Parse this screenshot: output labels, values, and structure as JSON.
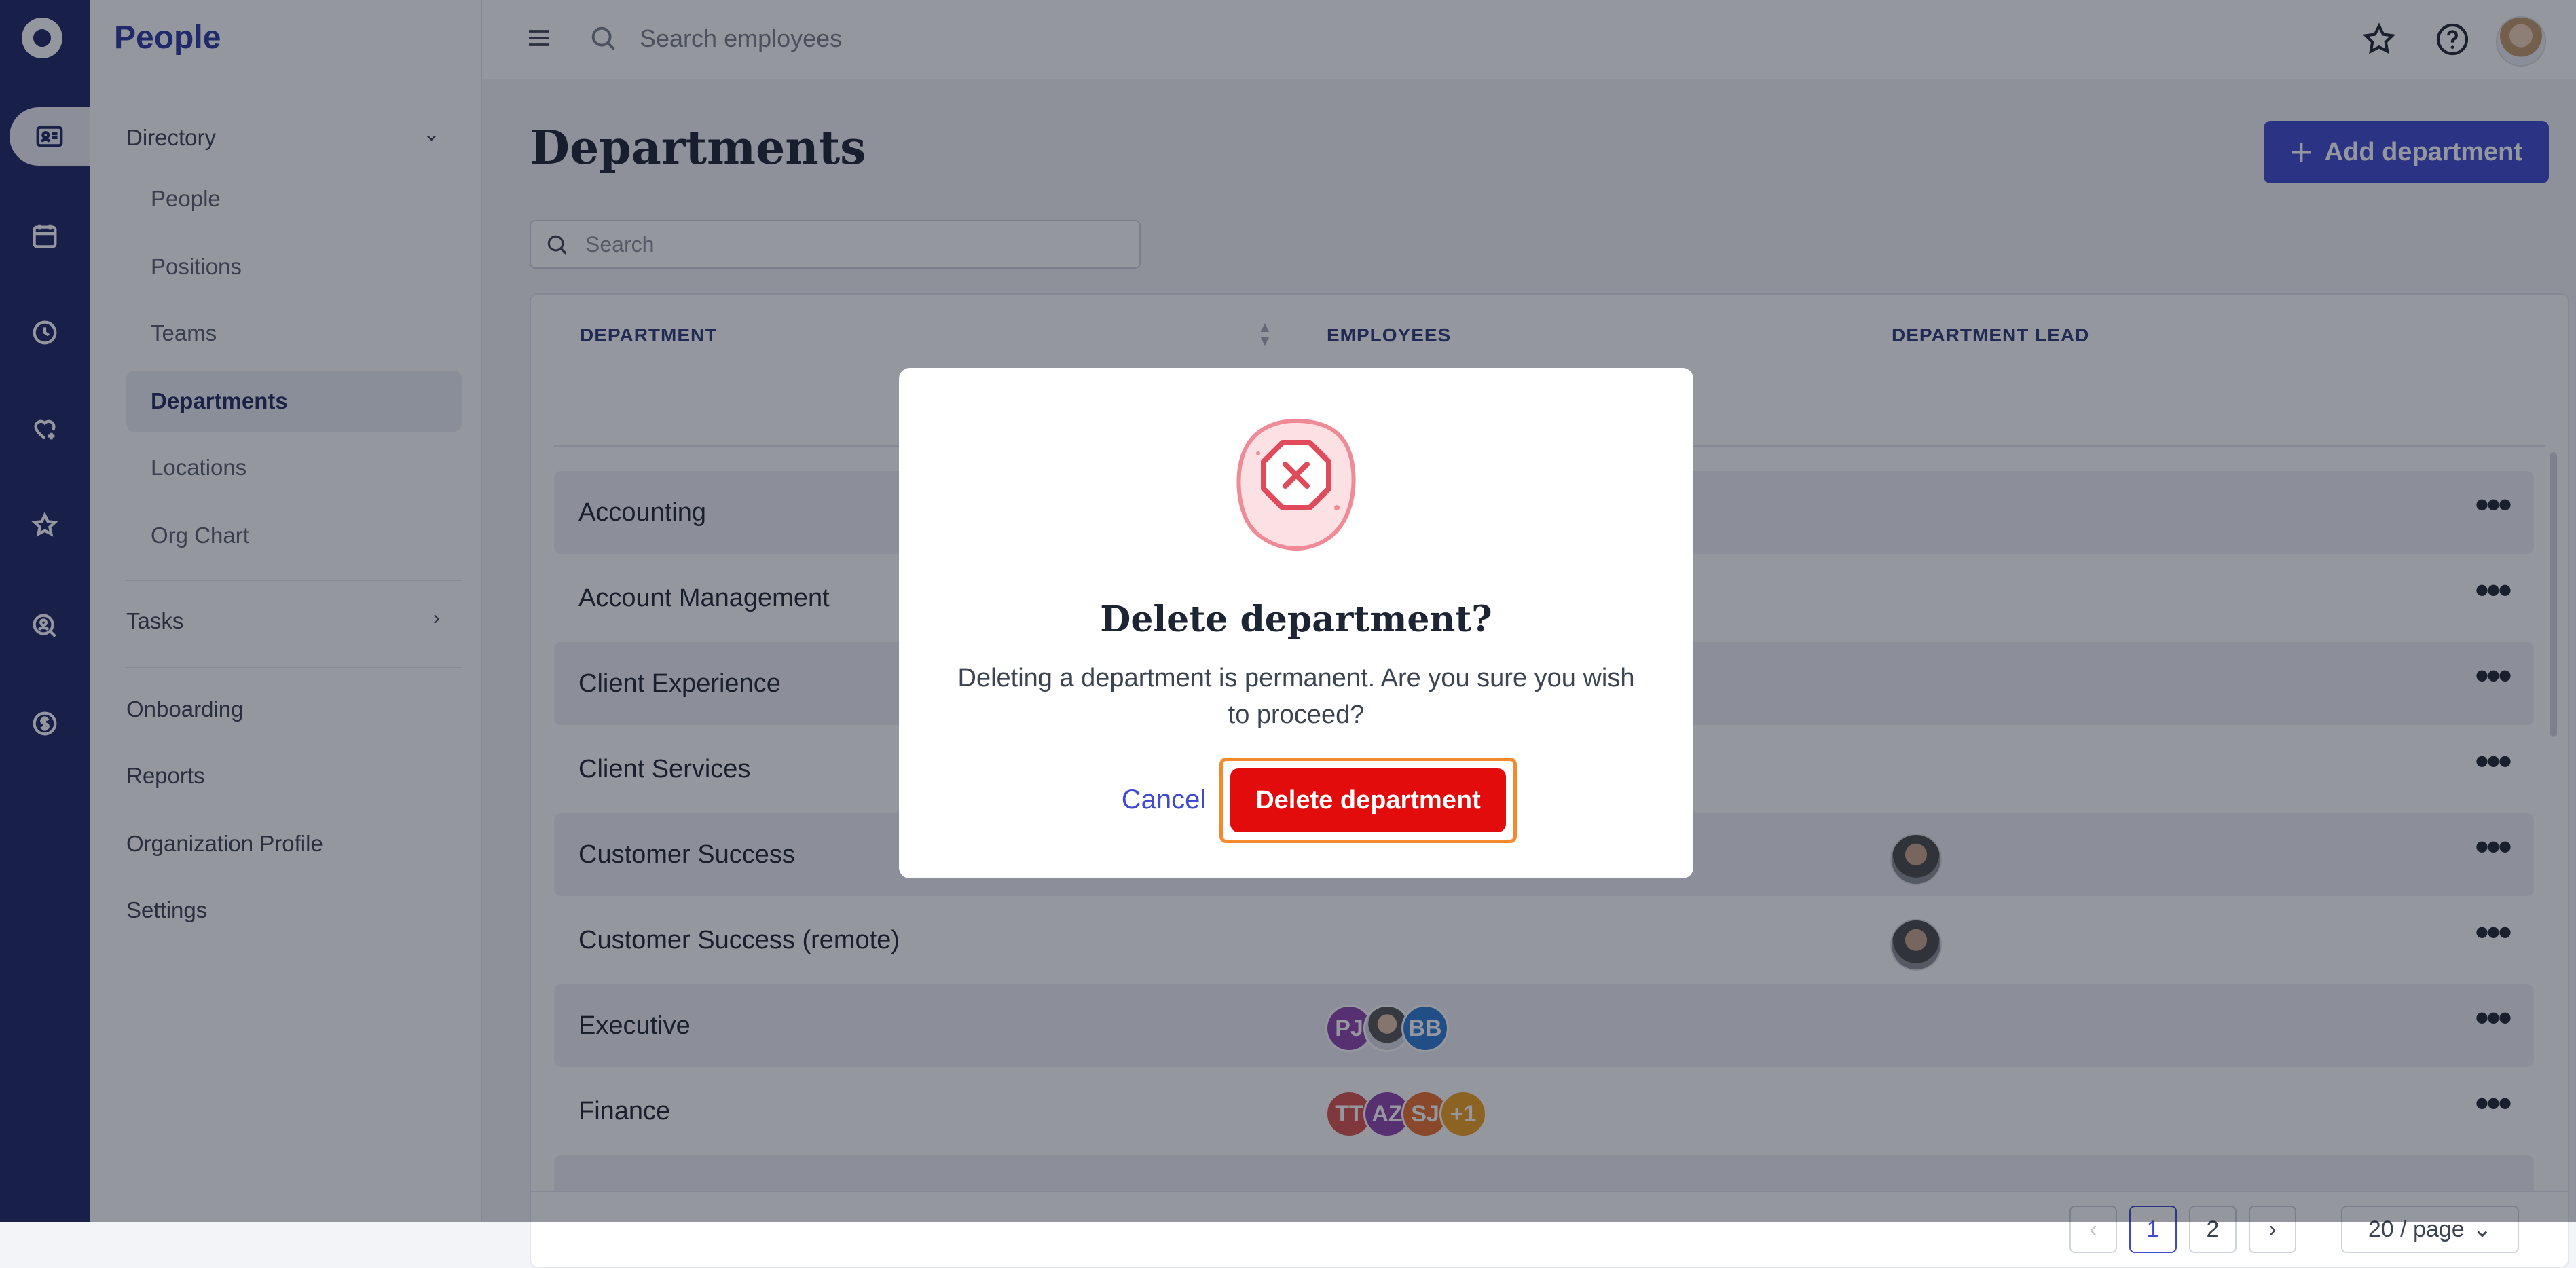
{
  "app": {
    "title": "People"
  },
  "rail": {
    "icons": [
      "logo-icon",
      "contact-card-icon",
      "calendar-icon",
      "clock-icon",
      "heart-icon",
      "star-icon",
      "person-search-icon",
      "dollar-icon"
    ]
  },
  "sidebar": {
    "directory_label": "Directory",
    "directory_items": [
      {
        "label": "People",
        "selected": false
      },
      {
        "label": "Positions",
        "selected": false
      },
      {
        "label": "Teams",
        "selected": false
      },
      {
        "label": "Departments",
        "selected": true
      },
      {
        "label": "Locations",
        "selected": false
      },
      {
        "label": "Org Chart",
        "selected": false
      }
    ],
    "tasks_label": "Tasks",
    "onboarding_label": "Onboarding",
    "reports_label": "Reports",
    "org_profile_label": "Organization Profile",
    "settings_label": "Settings"
  },
  "topbar": {
    "search_placeholder": "Search employees"
  },
  "page": {
    "title": "Departments",
    "add_button": "Add department",
    "search_placeholder": "Search"
  },
  "table": {
    "headers": {
      "department": "DEPARTMENT",
      "employees": "EMPLOYEES",
      "lead": "DEPARTMENT LEAD"
    },
    "rows": [
      {
        "name": "Accounting"
      },
      {
        "name": "Account Management"
      },
      {
        "name": "Client Experience"
      },
      {
        "name": "Client Services"
      },
      {
        "name": "Customer Success"
      },
      {
        "name": "Customer Success (remote)"
      },
      {
        "name": "Executive",
        "avatars": [
          {
            "text": "PJ",
            "color": "#8e44ad"
          },
          {
            "text": "",
            "color": "#9aa0a8"
          },
          {
            "text": "BB",
            "color": "#2e7bd6"
          }
        ]
      },
      {
        "name": "Finance",
        "avatars": [
          {
            "text": "TT",
            "color": "#d9534f"
          },
          {
            "text": "AZ",
            "color": "#8e44ad"
          },
          {
            "text": "SJ",
            "color": "#e8702a"
          },
          {
            "text": "+1",
            "color": "#f0a020"
          }
        ]
      }
    ],
    "pagination": {
      "pages": [
        "1",
        "2"
      ],
      "current": "1",
      "page_size": "20 / page"
    }
  },
  "modal": {
    "title": "Delete department?",
    "body": "Deleting a department is permanent. Are you sure you wish to proceed?",
    "cancel": "Cancel",
    "confirm": "Delete department"
  },
  "colors": {
    "primary": "#3f4bcf",
    "rail": "#1c2664",
    "danger": "#e20c0c",
    "highlight": "#f5892e"
  }
}
